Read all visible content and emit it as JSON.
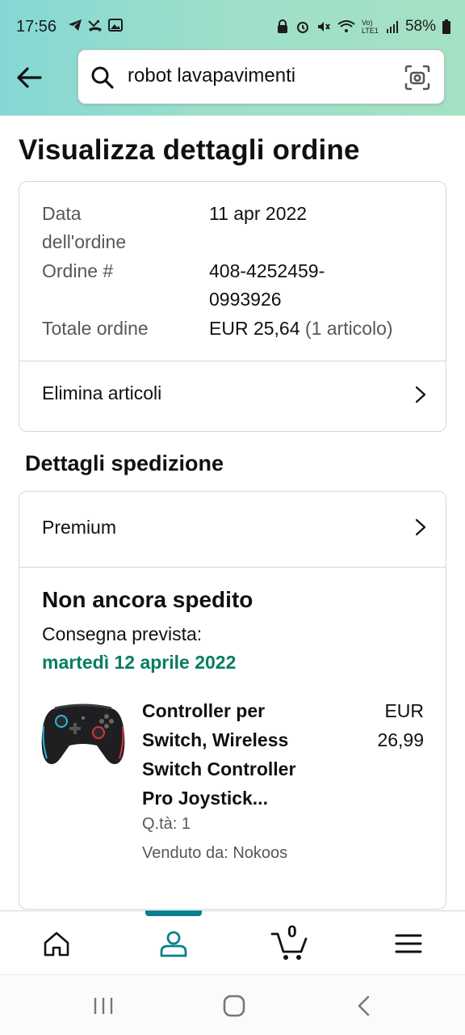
{
  "status_bar": {
    "time": "17:56",
    "battery": "58%",
    "network_label": "Vo) LTE1"
  },
  "header": {
    "search_value": "robot lavapavimenti"
  },
  "page": {
    "title": "Visualizza dettagli ordine"
  },
  "order_summary": {
    "date_label_line1": "Data",
    "date_label_line2": "dell'ordine",
    "date_value": "11 apr 2022",
    "order_label": "Ordine #",
    "order_value_line1": "408-4252459-",
    "order_value_line2": "0993926",
    "total_label": "Totale ordine",
    "total_value": "EUR 25,64",
    "total_items": "(1 articolo)",
    "remove_items_label": "Elimina articoli"
  },
  "shipping": {
    "section_title": "Dettagli spedizione",
    "method_label": "Premium",
    "status": "Non ancora spedito",
    "delivery_label": "Consegna prevista:",
    "delivery_date": "martedì 12 aprile 2022",
    "item": {
      "name_line1": "Controller per",
      "name_line2": "Switch, Wireless",
      "name_line3": "Switch Controller",
      "name_line4": "Pro Joystick...",
      "price_currency": "EUR",
      "price_amount": "26,99",
      "quantity": "Q.tà: 1",
      "seller": "Venduto da: Nokoos"
    }
  },
  "bottom_nav": {
    "cart_count": "0",
    "active_tab": "account"
  },
  "colors": {
    "accent_teal": "#0a7f8f",
    "delivery_green": "#067d62",
    "header_gradient_start": "#84d8d5",
    "header_gradient_end": "#a5e1c3"
  }
}
